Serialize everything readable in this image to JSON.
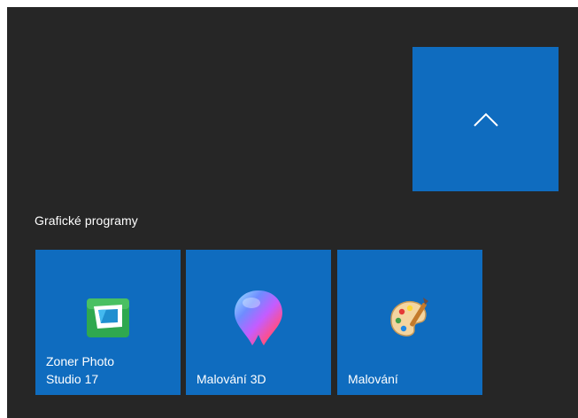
{
  "collapse_button": {
    "icon": "chevron-up-icon"
  },
  "group": {
    "title": "Grafické programy",
    "tiles": [
      {
        "label": "Zoner Photo\nStudio 17",
        "icon": "zoner-photo-studio-icon"
      },
      {
        "label": "Malování 3D",
        "icon": "paint-3d-icon"
      },
      {
        "label": "Malování",
        "icon": "paint-palette-icon"
      }
    ]
  },
  "colors": {
    "panel_background": "#262626",
    "tile_background": "#0f6cbf",
    "text": "#ffffff"
  }
}
